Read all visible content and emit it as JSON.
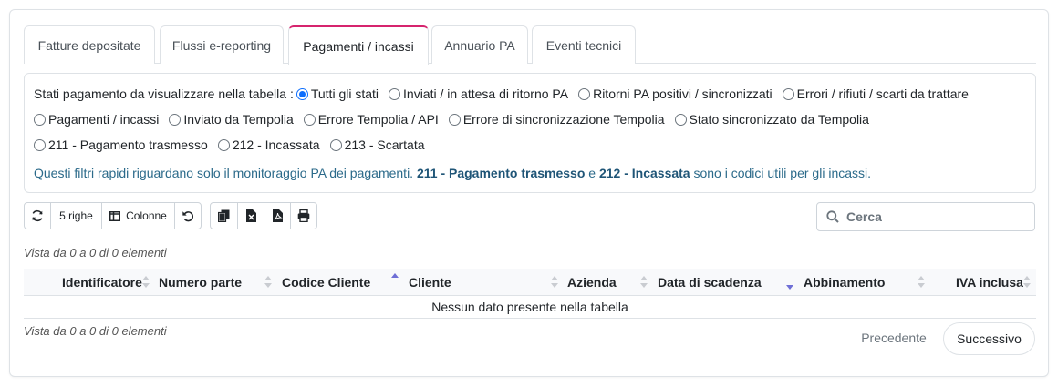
{
  "tabs": [
    {
      "label": "Fatture depositate"
    },
    {
      "label": "Flussi e-reporting"
    },
    {
      "label": "Pagamenti / incassi"
    },
    {
      "label": "Annuario PA"
    },
    {
      "label": "Eventi tecnici"
    }
  ],
  "filters": {
    "label": "Stati pagamento da visualizzare nella tabella :",
    "options": [
      {
        "label": "Tutti gli stati",
        "checked": true
      },
      {
        "label": "Inviati / in attesa di ritorno PA"
      },
      {
        "label": "Ritorni PA positivi / sincronizzati"
      },
      {
        "label": "Errori / rifiuti / scarti da trattare"
      },
      {
        "label": "Pagamenti / incassi"
      },
      {
        "label": "Inviato da Tempolia"
      },
      {
        "label": "Errore Tempolia / API"
      },
      {
        "label": "Errore di sincronizzazione Tempolia"
      },
      {
        "label": "Stato sincronizzato da Tempolia"
      },
      {
        "label": "211 - Pagamento trasmesso"
      },
      {
        "label": "212 - Incassata"
      },
      {
        "label": "213 - Scartata"
      }
    ],
    "note": {
      "prefix": "Questi filtri rapidi riguardano solo il monitoraggio PA dei pagamenti.",
      "code1": "211 - Pagamento trasmesso",
      "and": "e",
      "code2": "212 - Incassata",
      "suffix": "sono i codici utili per gli incassi."
    }
  },
  "toolbar": {
    "refresh_icon": "refresh-icon",
    "rows_label": "5 righe",
    "columns_label": "Colonne",
    "reset_icon": "undo-icon",
    "copy_icon": "copy-icon",
    "excel_icon": "excel-icon",
    "pdf_icon": "pdf-icon",
    "print_icon": "print-icon"
  },
  "search": {
    "placeholder": "Cerca"
  },
  "table": {
    "info_top": "Vista da 0 a 0 di 0 elementi",
    "info_bottom": "Vista da 0 a 0 di 0 elementi",
    "columns": [
      {
        "label": "Identificatore"
      },
      {
        "label": "Numero parte"
      },
      {
        "label": "Codice Cliente",
        "sort": "asc"
      },
      {
        "label": "Cliente"
      },
      {
        "label": "Azienda"
      },
      {
        "label": "Data di scadenza",
        "sort": "desc"
      },
      {
        "label": "Abbinamento"
      },
      {
        "label": "IVA inclusa"
      }
    ],
    "empty": "Nessun dato presente nella tabella"
  },
  "pager": {
    "prev": "Precedente",
    "next": "Successivo"
  },
  "colors": {
    "accent": "#d6246e",
    "radio": "#0d6efd",
    "note": "#2b6a8a"
  }
}
